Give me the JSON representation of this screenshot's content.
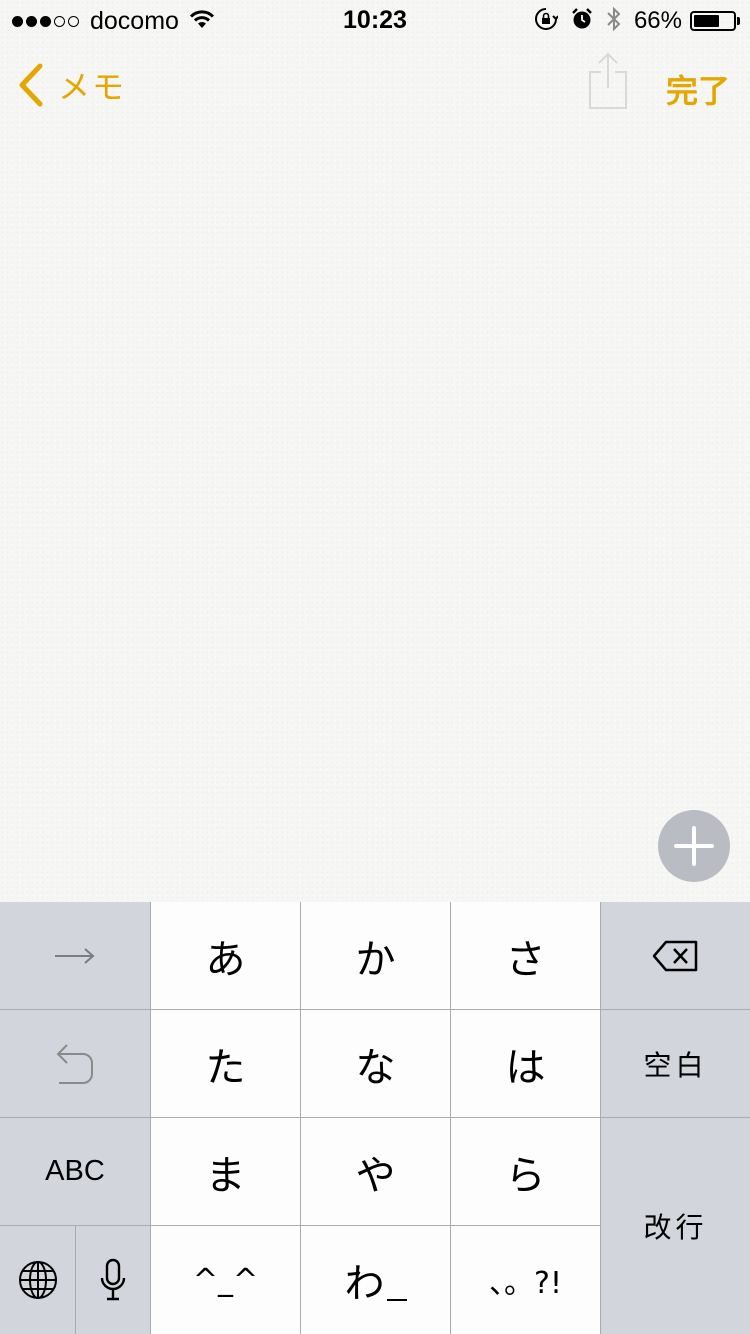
{
  "status_bar": {
    "carrier": "docomo",
    "signal_dots_filled": 3,
    "signal_dots_total": 5,
    "time": "10:23",
    "battery_percent_label": "66%",
    "battery_level": 0.66,
    "icons": [
      "wifi-icon",
      "orientation-lock-icon",
      "alarm-icon",
      "bluetooth-icon",
      "battery-icon"
    ]
  },
  "nav": {
    "back_label": "メモ",
    "done_label": "完了",
    "accent_color": "#e5a600"
  },
  "keyboard": {
    "row1": [
      "→",
      "あ",
      "か",
      "さ",
      "delete"
    ],
    "row2": [
      "undo",
      "た",
      "な",
      "は",
      "空白"
    ],
    "row3": [
      "ABC",
      "ま",
      "や",
      "ら"
    ],
    "row4": [
      "globe",
      "mic",
      "^_^",
      "わ_",
      "、。?!"
    ],
    "space_label": "空白",
    "return_label": "改行",
    "abc_label": "ABC",
    "emoticon_label": "^_^",
    "wa_label": "わ",
    "punct_label": "、。?!"
  },
  "colors": {
    "paper": "#f6f6f5",
    "key_white": "#fdfdfd",
    "key_gray": "#d2d5db",
    "plus_button": "#b9bdc3"
  }
}
